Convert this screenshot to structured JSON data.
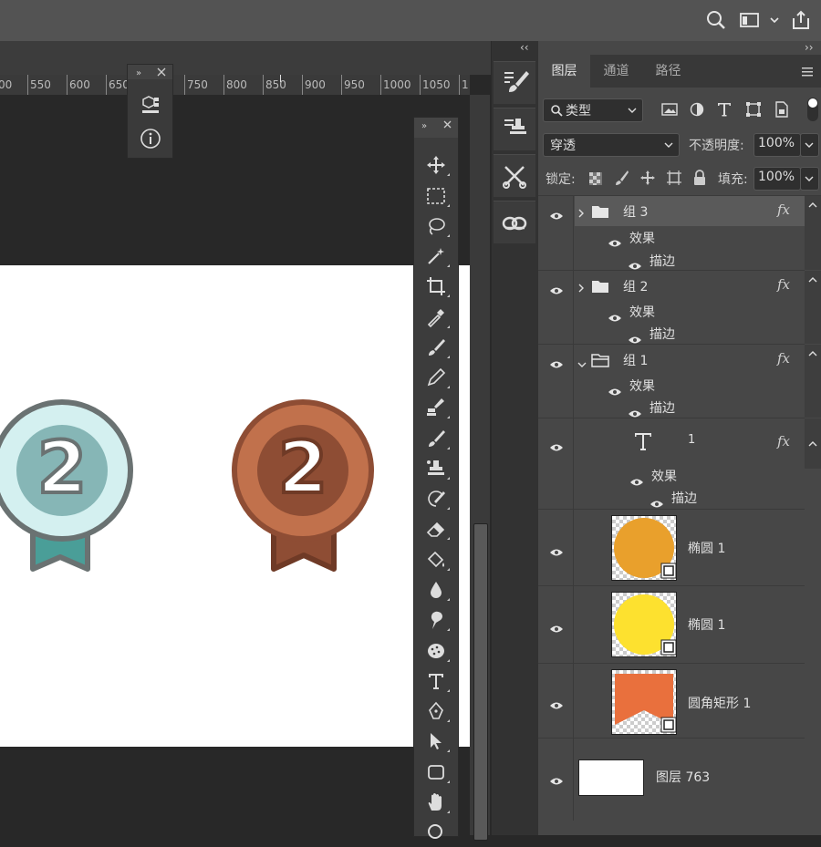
{
  "ruler": {
    "ticks": [
      "00",
      "550",
      "600",
      "650",
      "750",
      "800",
      "850",
      "900",
      "950",
      "1000",
      "1050",
      "1"
    ]
  },
  "panel": {
    "tabs": [
      "图层",
      "通道",
      "路径"
    ],
    "filter_label": "类型",
    "blend_mode": "穿透",
    "opacity_label": "不透明度:",
    "opacity_value": "100%",
    "lock_label": "锁定:",
    "fill_label": "填充:",
    "fill_value": "100%"
  },
  "layers": {
    "group3": {
      "name": "组 3",
      "effects": "效果",
      "stroke": "描边"
    },
    "group2": {
      "name": "组 2",
      "effects": "效果",
      "stroke": "描边"
    },
    "group1": {
      "name": "组 1",
      "effects": "效果",
      "stroke": "描边"
    },
    "text1": {
      "name": "1",
      "effects": "效果",
      "stroke": "描边"
    },
    "ellipse_orange": {
      "name": "椭圆 1"
    },
    "ellipse_yellow": {
      "name": "椭圆 1"
    },
    "rounded_rect": {
      "name": "圆角矩形 1"
    },
    "background": {
      "name": "图层 763"
    }
  },
  "fx_symbol": "fx",
  "canvas": {
    "medal_left_number": "2",
    "medal_right_number": "2"
  },
  "colors": {
    "ui_dark": "#282828",
    "panel_bg": "#474747",
    "silver_medal_fill": "#d4f0f0",
    "silver_medal_stroke": "#6a7272",
    "silver_ribbon": "#4a9e98",
    "bronze_medal_fill": "#c1714c",
    "bronze_medal_inner": "#8e4d34",
    "bronze_ribbon": "#8e4d34",
    "thumb_orange": "#e9a02c",
    "thumb_yellow": "#fde12f",
    "thumb_rect": "#e9703d"
  }
}
